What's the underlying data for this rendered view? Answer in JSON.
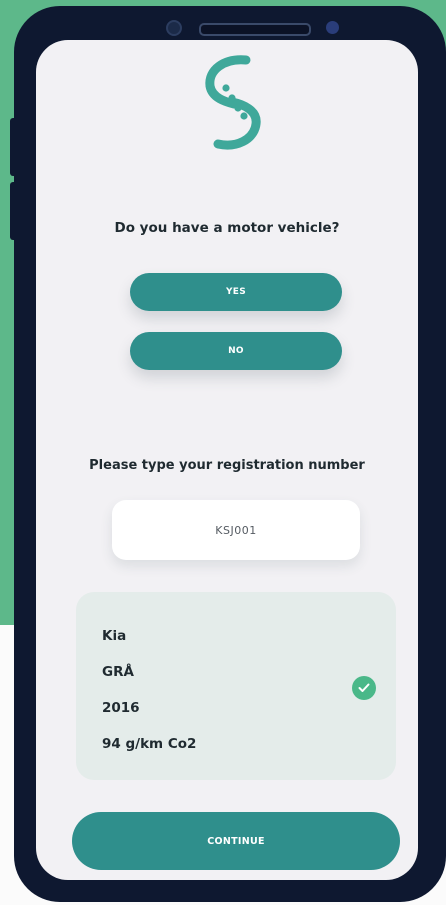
{
  "colors": {
    "background_green": "#5db88a",
    "phone_frame": "#0e1830",
    "screen_bg": "#f2f1f4",
    "primary_teal": "#2f8f8c",
    "logo_teal": "#3fa89a",
    "check_green": "#4ab889",
    "card_bg": "#e4ecea"
  },
  "header": {
    "logo_icon": "s-logo-icon"
  },
  "question": {
    "text": "Do you have a motor vehicle?"
  },
  "answers": {
    "yes_label": "YES",
    "no_label": "NO"
  },
  "registration": {
    "label": "Please type your registration number",
    "value": "KSJ001"
  },
  "vehicle": {
    "make": "Kia",
    "color": "GRÅ",
    "year": "2016",
    "emissions": "94 g/km Co2",
    "verified_icon": "check-circle-icon"
  },
  "footer": {
    "continue_label": "CONTINUE"
  }
}
